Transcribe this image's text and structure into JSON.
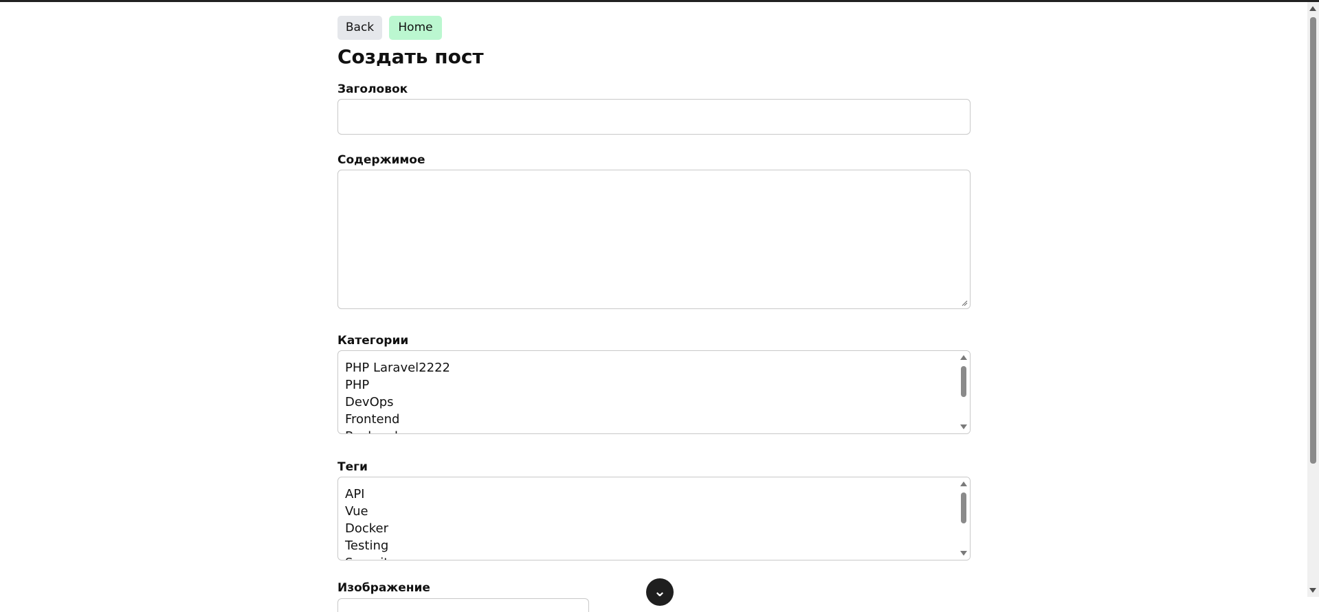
{
  "nav": {
    "back_label": "Back",
    "home_label": "Home"
  },
  "page": {
    "title": "Создать пост"
  },
  "form": {
    "title_label": "Заголовок",
    "title_value": "",
    "content_label": "Содержимое",
    "content_value": "",
    "categories_label": "Категории",
    "categories": [
      "PHP Laravel2222",
      "PHP",
      "DevOps",
      "Frontend",
      "Backend"
    ],
    "tags_label": "Теги",
    "tags": [
      "API",
      "Vue",
      "Docker",
      "Testing",
      "Security"
    ],
    "image_label": "Изображение"
  },
  "floating_button": {
    "icon": "chevron-down-icon",
    "glyph": "⌄"
  },
  "colors": {
    "back_button_bg": "#e5e7eb",
    "home_button_bg": "#bbf7d0"
  }
}
